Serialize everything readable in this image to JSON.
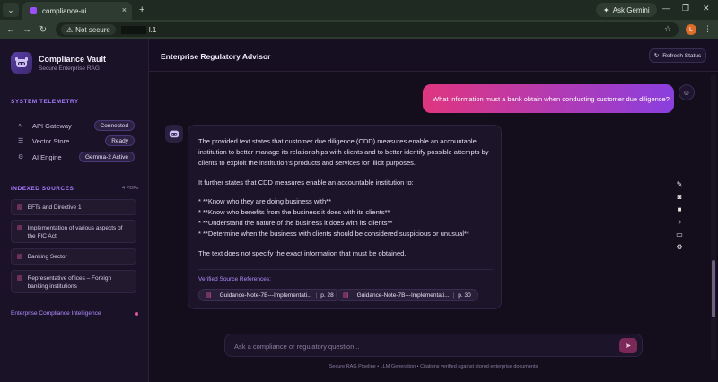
{
  "browser": {
    "tab_title": "compliance-ui",
    "tab_close": "×",
    "new_tab": "+",
    "ask_gemini": "Ask Gemini",
    "not_secure": "Not secure",
    "url_suffix": "l.1"
  },
  "sidebar": {
    "brand_name": "Compliance Vault",
    "brand_sub": "Secure Enterprise RAG",
    "telemetry_title": "SYSTEM TELEMETRY",
    "telemetry": [
      {
        "label": "API Gateway",
        "status": "Connected"
      },
      {
        "label": "Vector Store",
        "status": "Ready"
      },
      {
        "label": "AI Engine",
        "status": "Gemma-2 Active"
      }
    ],
    "sources_title": "INDEXED SOURCES",
    "sources_count": "4 PDFs",
    "sources": [
      "EFTs and Directive 1",
      "Implementation of various aspects of the FIC Act",
      "Banking Sector",
      "Representative offices – Foreign banking institutions"
    ],
    "footer": "Enterprise Compliance Intelligence"
  },
  "header": {
    "title": "Enterprise Regulatory Advisor",
    "refresh": "Refresh Status"
  },
  "chat": {
    "user_message": "What information must a bank obtain when conducting customer due diligence?",
    "bot_paragraphs": [
      "The provided text states that customer due diligence (CDD) measures enable an accountable institution to better manage its relationships with clients and to better identify possible attempts by clients to exploit the institution's products and services for illicit purposes.",
      "It further states that CDD measures enable an accountable institution to:",
      "* **Know who they are doing business with**",
      "* **Know who benefits from the business it does with its clients**",
      "* **Understand the nature of the business it does with its clients**",
      "* **Determine when the business with clients should be considered suspicious or unusual**",
      "The text does not specify the exact information that must be obtained."
    ],
    "refs_label": "Verified Source References:",
    "refs": [
      {
        "doc": "Guidance-Note-7B---Implementati...",
        "page": "p. 28"
      },
      {
        "doc": "Guidance-Note-7B---Implementati...",
        "page": "p. 30"
      }
    ]
  },
  "composer": {
    "placeholder": "Ask a compliance or regulatory question..."
  },
  "footer_note": "Secure RAG Pipeline • LLM Generation • Citations verified against stored enterprise documents"
}
